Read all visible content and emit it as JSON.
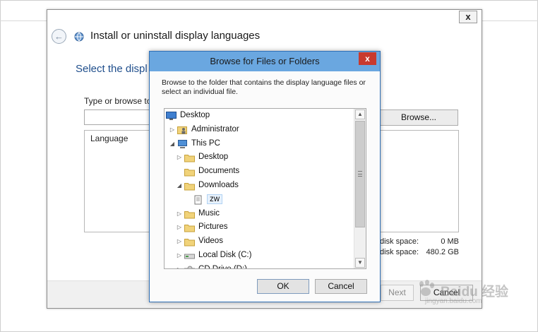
{
  "wizard": {
    "close_glyph": "x",
    "title": "Install or uninstall display languages",
    "heading": "Select the displ",
    "type_label": "Type or browse to",
    "browse_label": "Browse...",
    "list_column": "Language",
    "disk_rows": [
      {
        "label": "disk space:",
        "value": "0 MB"
      },
      {
        "label": "disk space:",
        "value": "480.2 GB"
      }
    ],
    "next_label": "Next",
    "cancel_label": "Cancel"
  },
  "dialog": {
    "title": "Browse for Files or Folders",
    "close_glyph": "x",
    "description": "Browse to the folder that contains the display language files or select an individual file.",
    "tree": [
      {
        "label": "Desktop",
        "arrow": "",
        "icon": "desktop-icon",
        "level": 0
      },
      {
        "label": "Administrator",
        "arrow": "▷",
        "icon": "user-folder-icon",
        "level": 1
      },
      {
        "label": "This PC",
        "arrow": "◢",
        "icon": "computer-icon",
        "level": 1
      },
      {
        "label": "Desktop",
        "arrow": "▷",
        "icon": "folder-icon",
        "level": 2
      },
      {
        "label": "Documents",
        "arrow": "",
        "icon": "folder-icon",
        "level": 2
      },
      {
        "label": "Downloads",
        "arrow": "◢",
        "icon": "folder-icon",
        "level": 2
      },
      {
        "label": "zw",
        "arrow": "",
        "icon": "file-icon",
        "level": 3,
        "selected": true
      },
      {
        "label": "Music",
        "arrow": "▷",
        "icon": "folder-icon",
        "level": 2
      },
      {
        "label": "Pictures",
        "arrow": "▷",
        "icon": "folder-icon",
        "level": 2
      },
      {
        "label": "Videos",
        "arrow": "▷",
        "icon": "folder-icon",
        "level": 2
      },
      {
        "label": "Local Disk (C:)",
        "arrow": "▷",
        "icon": "drive-icon",
        "level": 2
      },
      {
        "label": "CD Drive (D:)",
        "arrow": "▷",
        "icon": "cd-drive-icon",
        "level": 2
      }
    ],
    "ok_label": "OK",
    "cancel_label": "Cancel"
  },
  "watermark": {
    "main": "Baidu 经验",
    "sub": "jingyan.baidu.com"
  }
}
